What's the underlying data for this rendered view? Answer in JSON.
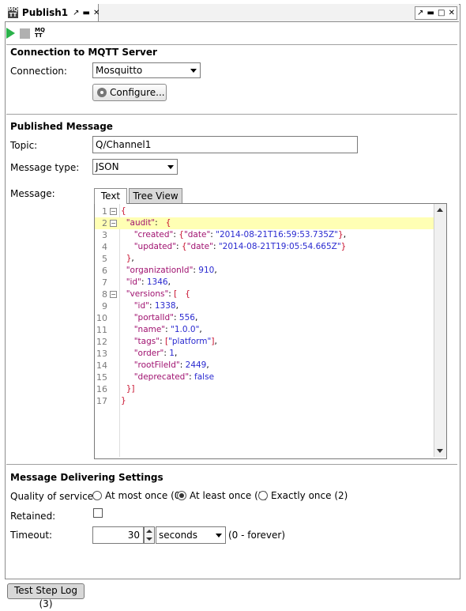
{
  "window": {
    "tab_title": "Publish1",
    "tab_icon_text": "MQ\nTT",
    "pin_glyph": "↗",
    "minimize_glyph": "▬",
    "close_glyph": "✕",
    "controls": [
      "↗",
      "▬",
      "□",
      "✕"
    ]
  },
  "toolbar": {
    "items": [
      "run-icon",
      "stop-icon",
      "mqtt-settings-icon"
    ],
    "mq_label": "MQ\nTT"
  },
  "connection": {
    "section_title": "Connection to MQTT Server",
    "label": "Connection:",
    "selected": "Mosquitto",
    "configure_label": "Configure..."
  },
  "message": {
    "section_title": "Published Message",
    "topic_label": "Topic:",
    "topic_value": "Q/Channel1",
    "type_label": "Message type:",
    "type_value": "JSON",
    "message_label": "Message:",
    "tabs": [
      "Text",
      "Tree View"
    ],
    "active_tab": "Text",
    "highlight_line": 2,
    "lines": [
      {
        "num": "1",
        "fold": "−",
        "html": "<span class='p'>{</span>"
      },
      {
        "num": "2",
        "fold": "−",
        "html": "  <span class='k'>\"audit\"</span>:   <span class='p'>{</span>"
      },
      {
        "num": "3",
        "fold": "",
        "html": "     <span class='k'>\"created\"</span>: <span class='p'>{</span><span class='k'>\"date\"</span>: <span class='s'>\"2014-08-21T16:59:53.735Z\"</span><span class='p'>}</span>,"
      },
      {
        "num": "4",
        "fold": "",
        "html": "     <span class='k'>\"updated\"</span>: <span class='p'>{</span><span class='k'>\"date\"</span>: <span class='s'>\"2014-08-21T19:05:54.665Z\"</span><span class='p'>}</span>"
      },
      {
        "num": "5",
        "fold": "",
        "html": "  <span class='p'>}</span>,"
      },
      {
        "num": "6",
        "fold": "",
        "html": "  <span class='k'>\"organizationId\"</span>: <span class='n'>910</span>,"
      },
      {
        "num": "7",
        "fold": "",
        "html": "  <span class='k'>\"id\"</span>: <span class='n'>1346</span>,"
      },
      {
        "num": "8",
        "fold": "−",
        "html": "  <span class='k'>\"versions\"</span>: <span class='p'>[</span>   <span class='p'>{</span>"
      },
      {
        "num": "9",
        "fold": "",
        "html": "     <span class='k'>\"id\"</span>: <span class='n'>1338</span>,"
      },
      {
        "num": "10",
        "fold": "",
        "html": "     <span class='k'>\"portalId\"</span>: <span class='n'>556</span>,"
      },
      {
        "num": "11",
        "fold": "",
        "html": "     <span class='k'>\"name\"</span>: <span class='s'>\"1.0.0\"</span>,"
      },
      {
        "num": "12",
        "fold": "",
        "html": "     <span class='k'>\"tags\"</span>: <span class='p'>[</span><span class='s'>\"platform\"</span><span class='p'>]</span>,"
      },
      {
        "num": "13",
        "fold": "",
        "html": "     <span class='k'>\"order\"</span>: <span class='n'>1</span>,"
      },
      {
        "num": "14",
        "fold": "",
        "html": "     <span class='k'>\"rootFileId\"</span>: <span class='n'>2449</span>,"
      },
      {
        "num": "15",
        "fold": "",
        "html": "     <span class='k'>\"deprecated\"</span>: <span class='n'>false</span>"
      },
      {
        "num": "16",
        "fold": "",
        "html": "  <span class='p'>}]</span>"
      },
      {
        "num": "17",
        "fold": "",
        "html": "<span class='p'>}</span>"
      }
    ]
  },
  "delivery": {
    "section_title": "Message Delivering Settings",
    "qos_label": "Quality of service:",
    "qos_options": [
      "At most once (0)",
      "At least once (1)",
      "Exactly once (2)"
    ],
    "qos_selected": "At least once (1)",
    "retained_label": "Retained:",
    "retained": false,
    "timeout_label": "Timeout:",
    "timeout_value": "30",
    "timeout_unit": "seconds",
    "timeout_hint": "(0 - forever)"
  },
  "bottom": {
    "log_tab": "Test Step Log (3)"
  }
}
